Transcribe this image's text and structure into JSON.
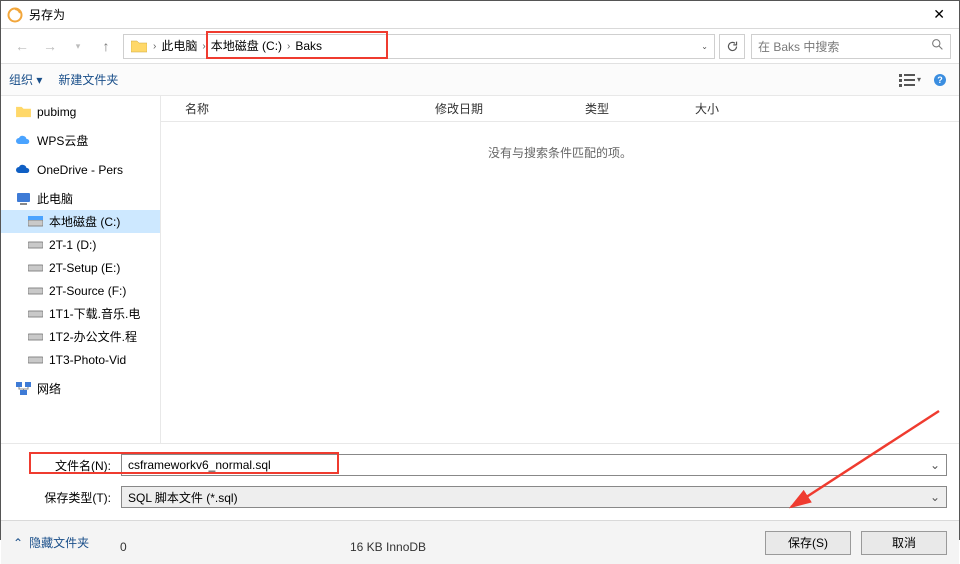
{
  "title": "另存为",
  "breadcrumb": {
    "root": "此电脑",
    "drive": "本地磁盘 (C:)",
    "folder": "Baks"
  },
  "search": {
    "placeholder": "在 Baks 中搜索"
  },
  "toolbar": {
    "organize": "组织 ▾",
    "newfolder": "新建文件夹"
  },
  "columns": {
    "name": "名称",
    "modified": "修改日期",
    "type": "类型",
    "size": "大小"
  },
  "empty_msg": "没有与搜索条件匹配的项。",
  "tree": {
    "pubimg": "pubimg",
    "wps": "WPS云盘",
    "onedrive": "OneDrive - Pers",
    "pc": "此电脑",
    "c": "本地磁盘 (C:)",
    "d": "2T-1 (D:)",
    "e": "2T-Setup (E:)",
    "f": "2T-Source (F:)",
    "g": "1T1-下载.音乐.电",
    "h": "1T2-办公文件.程",
    "i": "1T3-Photo-Vid",
    "net": "网络"
  },
  "filename_label": "文件名(N):",
  "filetype_label": "保存类型(T):",
  "filename_value": "csframeworkv6_normal.sql",
  "filetype_value": "SQL 脚本文件 (*.sql)",
  "hide_folders": "隐藏文件夹",
  "save_btn": "保存(S)",
  "cancel_btn": "取消",
  "under_left": "0",
  "under_right": "16 KB   InnoDB"
}
